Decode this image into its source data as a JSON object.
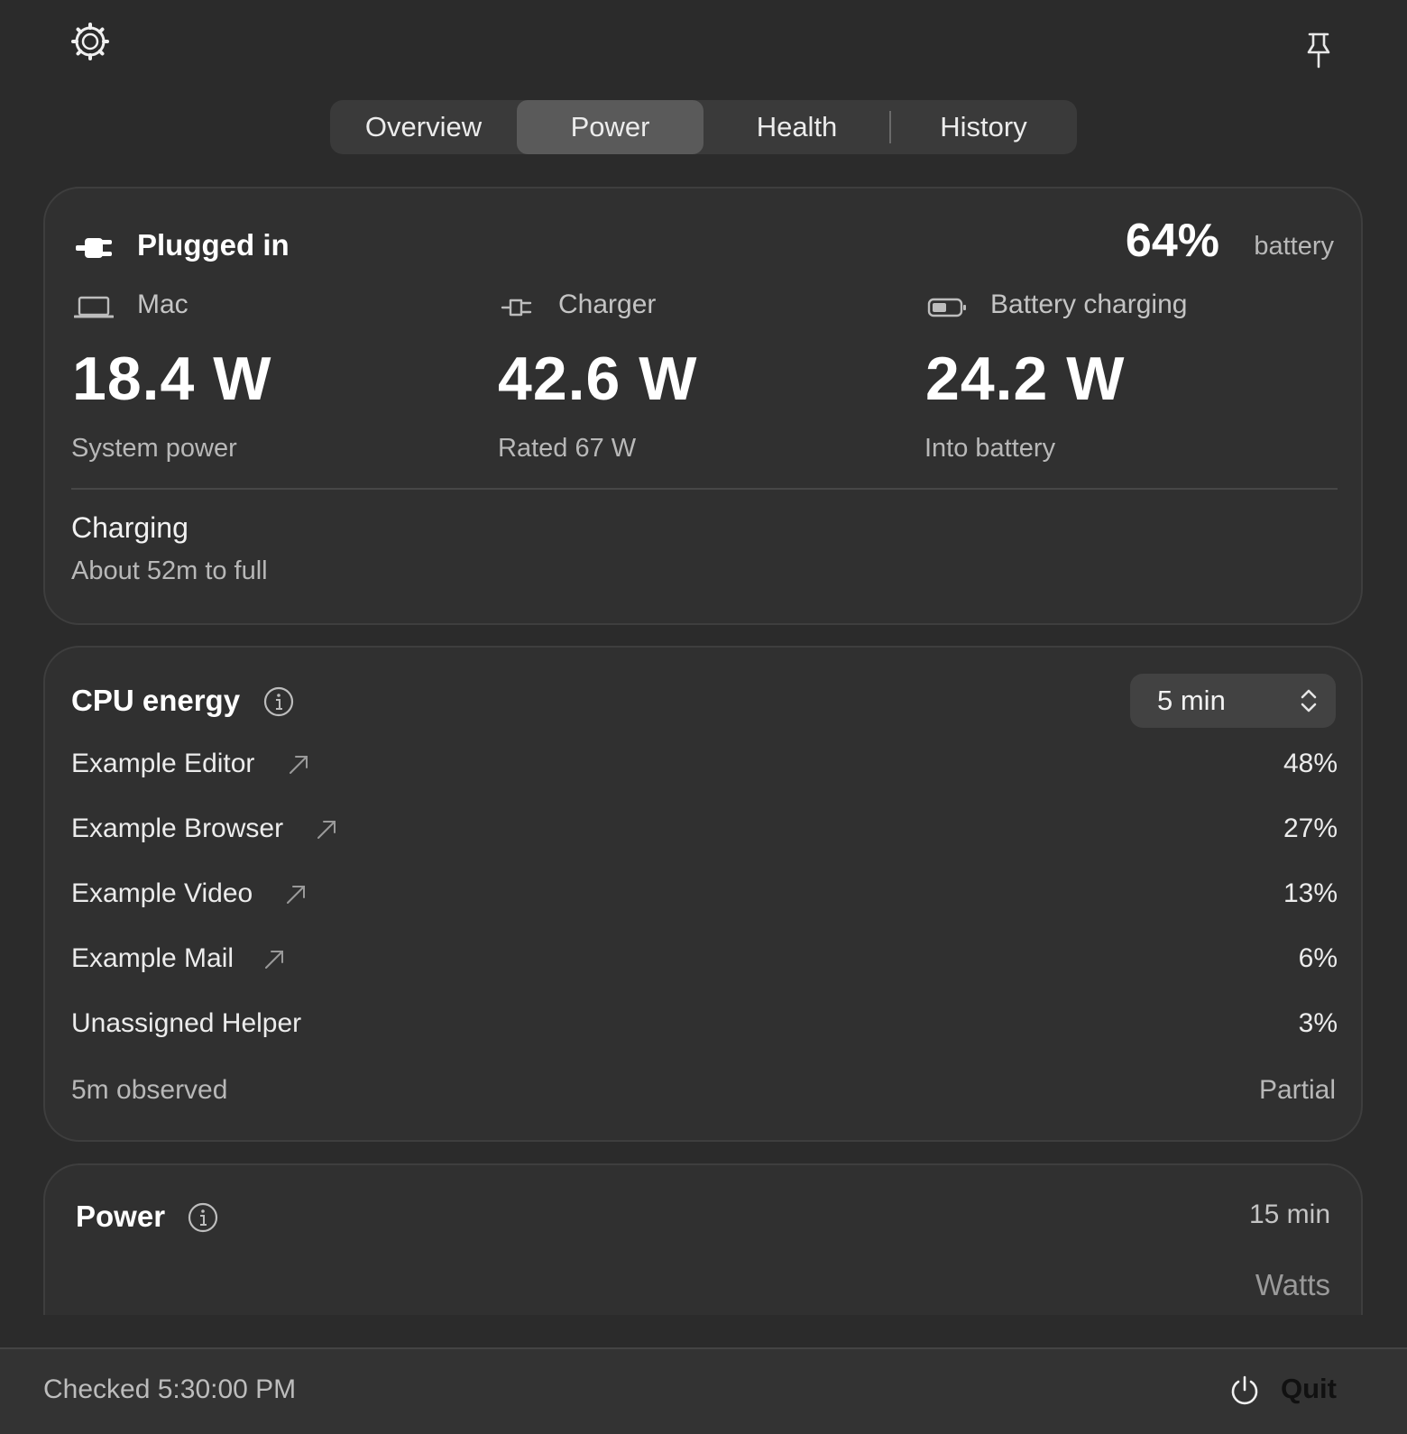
{
  "toolbar": {
    "settings_icon": "gear-icon",
    "pin_icon": "pin-icon"
  },
  "tabs": [
    {
      "label": "Overview",
      "active": false
    },
    {
      "label": "Power",
      "active": true
    },
    {
      "label": "Health",
      "active": false
    },
    {
      "label": "History",
      "active": false
    }
  ],
  "power_status": {
    "title": "Plugged in",
    "battery_percent": "64%",
    "battery_word": "battery",
    "columns": [
      {
        "icon": "laptop-icon",
        "label": "Mac",
        "value": "18.4 W",
        "sub": "System power"
      },
      {
        "icon": "charger-plug-icon",
        "label": "Charger",
        "value": "42.6 W",
        "sub": "Rated 67 W"
      },
      {
        "icon": "battery-icon",
        "label": "Battery charging",
        "value": "24.2 W",
        "sub": "Into battery"
      }
    ],
    "charging_title": "Charging",
    "charging_sub": "About 52m to full"
  },
  "cpu_energy": {
    "title": "CPU energy",
    "range": "5 min",
    "rows": [
      {
        "name": "Example Editor",
        "pct": "48%",
        "link": true
      },
      {
        "name": "Example Browser",
        "pct": "27%",
        "link": true
      },
      {
        "name": "Example Video",
        "pct": "13%",
        "link": true
      },
      {
        "name": "Example Mail",
        "pct": "6%",
        "link": true
      },
      {
        "name": "Unassigned Helper",
        "pct": "3%",
        "link": false
      }
    ],
    "observed": "5m observed",
    "coverage": "Partial"
  },
  "power_chart": {
    "title": "Power",
    "range": "15 min",
    "unit": "Watts"
  },
  "footer": {
    "checked": "Checked 5:30:00 PM",
    "quit": "Quit"
  },
  "colors": {
    "background": "#2b2b2b",
    "card": "#303030",
    "active_tab": "#5a5a5a"
  }
}
